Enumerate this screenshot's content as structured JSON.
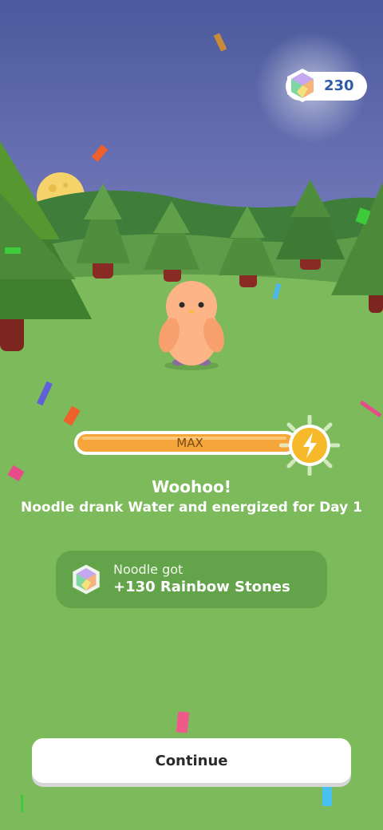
{
  "hud": {
    "currency_count": "230",
    "currency_icon": "rainbow-stone-icon"
  },
  "energy": {
    "label": "MAX",
    "level": 1.0,
    "icon": "lightning-bolt-icon"
  },
  "message": {
    "title": "Woohoo!",
    "subtitle": "Noodle drank Water and energized for Day 1"
  },
  "reward": {
    "line1": "Noodle got",
    "line2": "+130 Rainbow Stones",
    "icon": "rainbow-stone-icon"
  },
  "continue_label": "Continue",
  "colors": {
    "sky_top": "#4a5a9c",
    "grass": "#7cba5c",
    "bar_fill": "#f5a53a",
    "bolt": "#f5b92a",
    "currency_text": "#2e5aa8"
  }
}
